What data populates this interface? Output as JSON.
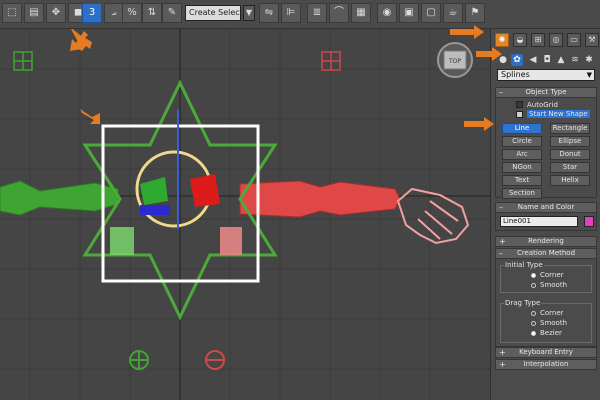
{
  "colors": {
    "accent_blue": "#2d6fc7",
    "highlight_orange": "#e0862b",
    "swatch": "#e040c8",
    "spline_green": "#3fa532",
    "star_green": "#4caa3a",
    "box_white": "#ffffff",
    "circle_yellow": "#f0d98a"
  },
  "toolbar": {
    "selection_set_value": "Create Selection S",
    "snap_label": "3",
    "angle_label": "%"
  },
  "panel": {
    "category_dropdown": "Splines",
    "object_type": {
      "header": "Object Type",
      "autogrid_label": "AutoGrid",
      "start_new_shape_label": "Start New Shape",
      "buttons": [
        "Line",
        "Rectangle",
        "Circle",
        "Ellipse",
        "Arc",
        "Donut",
        "NGon",
        "Star",
        "Text",
        "Helix",
        "Section"
      ]
    },
    "name_and_color": {
      "header": "Name and Color",
      "name_value": "Line001"
    },
    "rendering": {
      "header": "Rendering"
    },
    "creation_method": {
      "header": "Creation Method",
      "initial_type_label": "Initial Type",
      "initial_options": [
        "Corner",
        "Smooth"
      ],
      "drag_type_label": "Drag Type",
      "drag_options": [
        "Corner",
        "Smooth",
        "Bezier"
      ]
    },
    "keyboard_entry": {
      "header": "Keyboard Entry"
    },
    "interpolation": {
      "header": "Interpolation"
    }
  },
  "viewcube": {
    "face_label": "TOP"
  }
}
